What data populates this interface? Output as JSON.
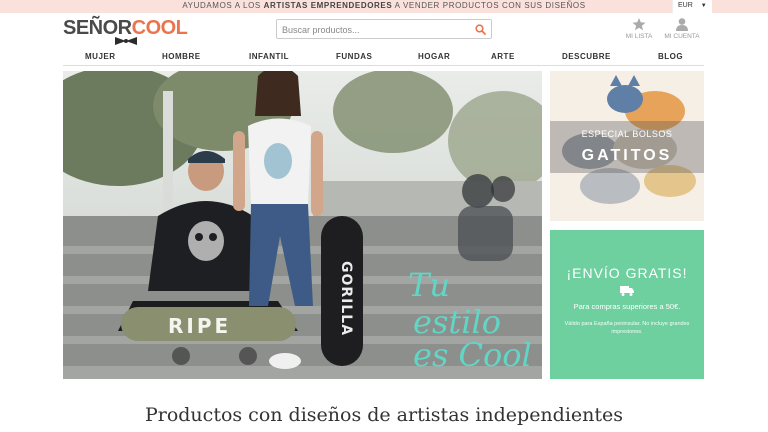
{
  "topbar": {
    "msg_pre": "AYUDAMOS A LOS ",
    "msg_bold": "ARTISTAS EMPRENDEDORES",
    "msg_post": " A VENDER PRODUCTOS CON SUS DISEÑOS",
    "currency": "EUR"
  },
  "logo": {
    "part1": "SEÑOR",
    "part2": "COOL"
  },
  "search": {
    "placeholder": "Buscar productos..."
  },
  "user": {
    "wishlist_label": "MI LISTA",
    "account_label": "MI CUENTA"
  },
  "nav": [
    "MUJER",
    "HOMBRE",
    "INFANTIL",
    "FUNDAS",
    "HOGAR",
    "ARTE",
    "DESCUBRE",
    "BLOG"
  ],
  "hero": {
    "tagline_1": "Tu",
    "tagline_2": "estilo",
    "tagline_3": "es Cool",
    "skateboard_text_1": "RIPE",
    "skateboard_text_2": "GORILLA"
  },
  "promo_bolsos": {
    "subtitle": "ESPECIAL BOLSOS",
    "title": "GATITOS"
  },
  "promo_envio": {
    "title": "¡ENVÍO GRATIS!",
    "subtitle": "Para compras superiores a 50€.",
    "note": "Válido para España peninsular. No incluye grandes impresiones."
  },
  "headline": "Productos con diseños de artistas independientes",
  "colors": {
    "accent": "#e9754f",
    "topbar_bg": "#fbe1dc",
    "promo_green": "#6ecf9f",
    "tagline": "#62d6c6"
  }
}
